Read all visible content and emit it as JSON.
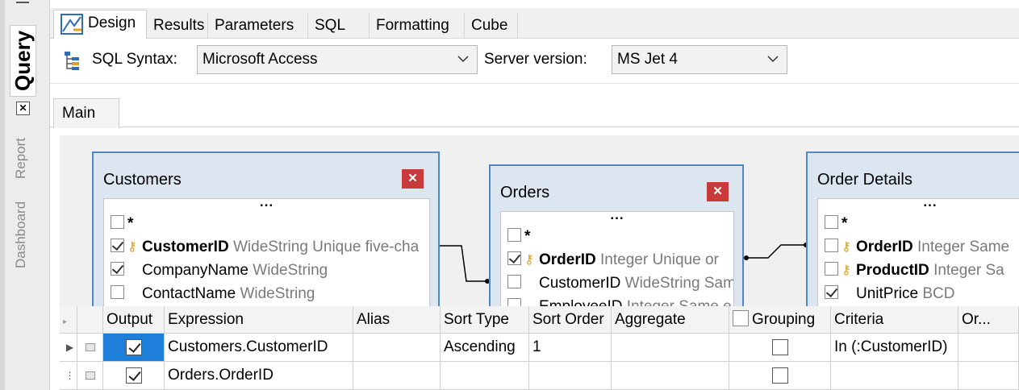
{
  "side_tabs": {
    "query": "Query",
    "report": "Report",
    "dashboard": "Dashboard"
  },
  "top_tabs": [
    "Design",
    "Results",
    "Parameters",
    "SQL",
    "Formatting",
    "Cube"
  ],
  "active_top_tab": "Design",
  "toolbar": {
    "syntax_label": "SQL Syntax:",
    "syntax_value": "Microsoft Access",
    "server_label": "Server version:",
    "server_value": "MS Jet 4"
  },
  "sub_tab": "Main",
  "tables": {
    "customers": {
      "title": "Customers",
      "fields": [
        {
          "name": "*",
          "type": "",
          "checked": false,
          "key": false,
          "bold": false
        },
        {
          "name": "CustomerID",
          "type": "WideString Unique five-cha",
          "checked": true,
          "key": true,
          "bold": true
        },
        {
          "name": "CompanyName",
          "type": "WideString",
          "checked": true,
          "key": false,
          "bold": false
        },
        {
          "name": "ContactName",
          "type": "WideString",
          "checked": false,
          "key": false,
          "bold": false
        }
      ]
    },
    "orders": {
      "title": "Orders",
      "fields": [
        {
          "name": "*",
          "type": "",
          "checked": false,
          "key": false,
          "bold": false
        },
        {
          "name": "OrderID",
          "type": "Integer Unique or",
          "checked": true,
          "key": true,
          "bold": true
        },
        {
          "name": "CustomerID",
          "type": "WideString Sam",
          "checked": false,
          "key": false,
          "bold": false
        },
        {
          "name": "EmployeeID",
          "type": "Integer Same e",
          "checked": false,
          "key": false,
          "bold": false
        }
      ]
    },
    "order_details": {
      "title": "Order Details",
      "fields": [
        {
          "name": "*",
          "type": "",
          "checked": false,
          "key": false,
          "bold": false
        },
        {
          "name": "OrderID",
          "type": "Integer Same",
          "checked": false,
          "key": true,
          "bold": true
        },
        {
          "name": "ProductID",
          "type": "Integer Sa",
          "checked": false,
          "key": true,
          "bold": true
        },
        {
          "name": "UnitPrice",
          "type": "BCD",
          "checked": true,
          "key": false,
          "bold": false
        }
      ]
    }
  },
  "grid": {
    "headers": {
      "output": "Output",
      "expression": "Expression",
      "alias": "Alias",
      "sort_type": "Sort Type",
      "sort_order": "Sort Order",
      "aggregate": "Aggregate",
      "grouping": "Grouping",
      "criteria": "Criteria",
      "or": "Or..."
    },
    "rows": [
      {
        "output": true,
        "expression": "Customers.CustomerID",
        "alias": "",
        "sort_type": "Ascending",
        "sort_order": "1",
        "aggregate": "",
        "grouping": false,
        "criteria": "In (:CustomerID)",
        "or": ""
      },
      {
        "output": true,
        "expression": "Orders.OrderID",
        "alias": "",
        "sort_type": "",
        "sort_order": "",
        "aggregate": "",
        "grouping": false,
        "criteria": "",
        "or": ""
      }
    ]
  }
}
